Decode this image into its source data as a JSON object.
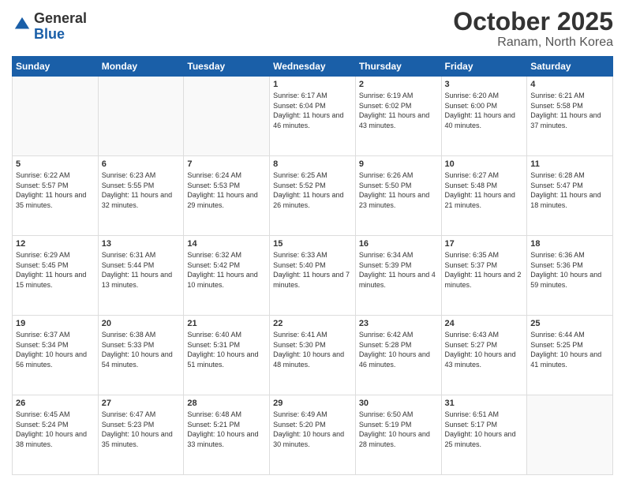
{
  "header": {
    "logo": {
      "general": "General",
      "blue": "Blue"
    },
    "title": "October 2025",
    "location": "Ranam, North Korea"
  },
  "weekdays": [
    "Sunday",
    "Monday",
    "Tuesday",
    "Wednesday",
    "Thursday",
    "Friday",
    "Saturday"
  ],
  "weeks": [
    [
      {
        "day": "",
        "sunrise": "",
        "sunset": "",
        "daylight": ""
      },
      {
        "day": "",
        "sunrise": "",
        "sunset": "",
        "daylight": ""
      },
      {
        "day": "",
        "sunrise": "",
        "sunset": "",
        "daylight": ""
      },
      {
        "day": "1",
        "sunrise": "Sunrise: 6:17 AM",
        "sunset": "Sunset: 6:04 PM",
        "daylight": "Daylight: 11 hours and 46 minutes."
      },
      {
        "day": "2",
        "sunrise": "Sunrise: 6:19 AM",
        "sunset": "Sunset: 6:02 PM",
        "daylight": "Daylight: 11 hours and 43 minutes."
      },
      {
        "day": "3",
        "sunrise": "Sunrise: 6:20 AM",
        "sunset": "Sunset: 6:00 PM",
        "daylight": "Daylight: 11 hours and 40 minutes."
      },
      {
        "day": "4",
        "sunrise": "Sunrise: 6:21 AM",
        "sunset": "Sunset: 5:58 PM",
        "daylight": "Daylight: 11 hours and 37 minutes."
      }
    ],
    [
      {
        "day": "5",
        "sunrise": "Sunrise: 6:22 AM",
        "sunset": "Sunset: 5:57 PM",
        "daylight": "Daylight: 11 hours and 35 minutes."
      },
      {
        "day": "6",
        "sunrise": "Sunrise: 6:23 AM",
        "sunset": "Sunset: 5:55 PM",
        "daylight": "Daylight: 11 hours and 32 minutes."
      },
      {
        "day": "7",
        "sunrise": "Sunrise: 6:24 AM",
        "sunset": "Sunset: 5:53 PM",
        "daylight": "Daylight: 11 hours and 29 minutes."
      },
      {
        "day": "8",
        "sunrise": "Sunrise: 6:25 AM",
        "sunset": "Sunset: 5:52 PM",
        "daylight": "Daylight: 11 hours and 26 minutes."
      },
      {
        "day": "9",
        "sunrise": "Sunrise: 6:26 AM",
        "sunset": "Sunset: 5:50 PM",
        "daylight": "Daylight: 11 hours and 23 minutes."
      },
      {
        "day": "10",
        "sunrise": "Sunrise: 6:27 AM",
        "sunset": "Sunset: 5:48 PM",
        "daylight": "Daylight: 11 hours and 21 minutes."
      },
      {
        "day": "11",
        "sunrise": "Sunrise: 6:28 AM",
        "sunset": "Sunset: 5:47 PM",
        "daylight": "Daylight: 11 hours and 18 minutes."
      }
    ],
    [
      {
        "day": "12",
        "sunrise": "Sunrise: 6:29 AM",
        "sunset": "Sunset: 5:45 PM",
        "daylight": "Daylight: 11 hours and 15 minutes."
      },
      {
        "day": "13",
        "sunrise": "Sunrise: 6:31 AM",
        "sunset": "Sunset: 5:44 PM",
        "daylight": "Daylight: 11 hours and 13 minutes."
      },
      {
        "day": "14",
        "sunrise": "Sunrise: 6:32 AM",
        "sunset": "Sunset: 5:42 PM",
        "daylight": "Daylight: 11 hours and 10 minutes."
      },
      {
        "day": "15",
        "sunrise": "Sunrise: 6:33 AM",
        "sunset": "Sunset: 5:40 PM",
        "daylight": "Daylight: 11 hours and 7 minutes."
      },
      {
        "day": "16",
        "sunrise": "Sunrise: 6:34 AM",
        "sunset": "Sunset: 5:39 PM",
        "daylight": "Daylight: 11 hours and 4 minutes."
      },
      {
        "day": "17",
        "sunrise": "Sunrise: 6:35 AM",
        "sunset": "Sunset: 5:37 PM",
        "daylight": "Daylight: 11 hours and 2 minutes."
      },
      {
        "day": "18",
        "sunrise": "Sunrise: 6:36 AM",
        "sunset": "Sunset: 5:36 PM",
        "daylight": "Daylight: 10 hours and 59 minutes."
      }
    ],
    [
      {
        "day": "19",
        "sunrise": "Sunrise: 6:37 AM",
        "sunset": "Sunset: 5:34 PM",
        "daylight": "Daylight: 10 hours and 56 minutes."
      },
      {
        "day": "20",
        "sunrise": "Sunrise: 6:38 AM",
        "sunset": "Sunset: 5:33 PM",
        "daylight": "Daylight: 10 hours and 54 minutes."
      },
      {
        "day": "21",
        "sunrise": "Sunrise: 6:40 AM",
        "sunset": "Sunset: 5:31 PM",
        "daylight": "Daylight: 10 hours and 51 minutes."
      },
      {
        "day": "22",
        "sunrise": "Sunrise: 6:41 AM",
        "sunset": "Sunset: 5:30 PM",
        "daylight": "Daylight: 10 hours and 48 minutes."
      },
      {
        "day": "23",
        "sunrise": "Sunrise: 6:42 AM",
        "sunset": "Sunset: 5:28 PM",
        "daylight": "Daylight: 10 hours and 46 minutes."
      },
      {
        "day": "24",
        "sunrise": "Sunrise: 6:43 AM",
        "sunset": "Sunset: 5:27 PM",
        "daylight": "Daylight: 10 hours and 43 minutes."
      },
      {
        "day": "25",
        "sunrise": "Sunrise: 6:44 AM",
        "sunset": "Sunset: 5:25 PM",
        "daylight": "Daylight: 10 hours and 41 minutes."
      }
    ],
    [
      {
        "day": "26",
        "sunrise": "Sunrise: 6:45 AM",
        "sunset": "Sunset: 5:24 PM",
        "daylight": "Daylight: 10 hours and 38 minutes."
      },
      {
        "day": "27",
        "sunrise": "Sunrise: 6:47 AM",
        "sunset": "Sunset: 5:23 PM",
        "daylight": "Daylight: 10 hours and 35 minutes."
      },
      {
        "day": "28",
        "sunrise": "Sunrise: 6:48 AM",
        "sunset": "Sunset: 5:21 PM",
        "daylight": "Daylight: 10 hours and 33 minutes."
      },
      {
        "day": "29",
        "sunrise": "Sunrise: 6:49 AM",
        "sunset": "Sunset: 5:20 PM",
        "daylight": "Daylight: 10 hours and 30 minutes."
      },
      {
        "day": "30",
        "sunrise": "Sunrise: 6:50 AM",
        "sunset": "Sunset: 5:19 PM",
        "daylight": "Daylight: 10 hours and 28 minutes."
      },
      {
        "day": "31",
        "sunrise": "Sunrise: 6:51 AM",
        "sunset": "Sunset: 5:17 PM",
        "daylight": "Daylight: 10 hours and 25 minutes."
      },
      {
        "day": "",
        "sunrise": "",
        "sunset": "",
        "daylight": ""
      }
    ]
  ]
}
